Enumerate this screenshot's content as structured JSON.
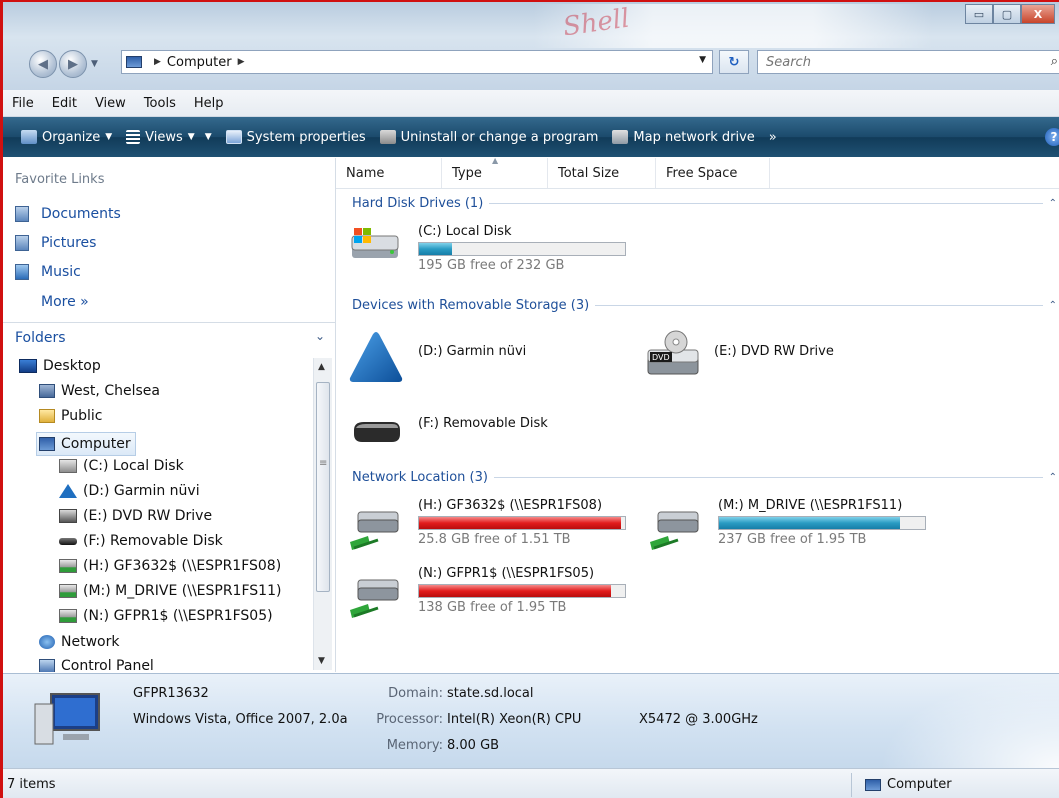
{
  "window": {
    "minimize_glyph": "▭",
    "maximize_glyph": "▢",
    "close_glyph": "X",
    "logo_text": "Shell"
  },
  "address": {
    "location": "Computer",
    "search_placeholder": "Search"
  },
  "menu": [
    "File",
    "Edit",
    "View",
    "Tools",
    "Help"
  ],
  "toolbar": {
    "organize": "Organize",
    "views": "Views",
    "system_properties": "System properties",
    "uninstall": "Uninstall or change a program",
    "map_drive": "Map network drive",
    "overflow": "»"
  },
  "nav": {
    "favorite_links_header": "Favorite Links",
    "favorites": [
      "Documents",
      "Pictures",
      "Music"
    ],
    "more": "More  »",
    "folders_header": "Folders",
    "tree": [
      {
        "label": "Desktop",
        "level": 0,
        "icon": "desktop-icon"
      },
      {
        "label": "West, Chelsea",
        "level": 1,
        "icon": "user-folder-icon"
      },
      {
        "label": "Public",
        "level": 1,
        "icon": "folder-icon"
      },
      {
        "label": "Computer",
        "level": 1,
        "icon": "computer-icon",
        "selected": true
      },
      {
        "label": "(C:) Local Disk",
        "level": 2,
        "icon": "local-disk-icon"
      },
      {
        "label": "(D:) Garmin nüvi",
        "level": 2,
        "icon": "garmin-icon"
      },
      {
        "label": "(E:) DVD RW Drive",
        "level": 2,
        "icon": "dvd-drive-icon"
      },
      {
        "label": "(F:) Removable Disk",
        "level": 2,
        "icon": "removable-disk-icon"
      },
      {
        "label": "(H:) GF3632$ (\\\\ESPR1FS08)",
        "level": 2,
        "icon": "network-drive-icon"
      },
      {
        "label": "(M:) M_DRIVE (\\\\ESPR1FS11)",
        "level": 2,
        "icon": "network-drive-icon"
      },
      {
        "label": "(N:) GFPR1$ (\\\\ESPR1FS05)",
        "level": 2,
        "icon": "network-drive-icon"
      },
      {
        "label": "Network",
        "level": 1,
        "icon": "network-icon"
      },
      {
        "label": "Control Panel",
        "level": 1,
        "icon": "control-panel-icon"
      }
    ]
  },
  "columns": [
    "Name",
    "Type",
    "Total Size",
    "Free Space"
  ],
  "groups": {
    "hdd": "Hard Disk Drives (1)",
    "removable": "Devices with Removable Storage (3)",
    "network": "Network Location (3)"
  },
  "drives": {
    "c": {
      "name": "(C:) Local Disk",
      "free": "195 GB free of 232 GB",
      "used_fraction": 0.16
    },
    "d": {
      "name": "(D:) Garmin nüvi"
    },
    "e": {
      "name": "(E:) DVD RW Drive",
      "badge": "DVD"
    },
    "f": {
      "name": "(F:) Removable Disk"
    },
    "h": {
      "name": "(H:) GF3632$ (\\\\ESPR1FS08)",
      "free": "25.8 GB free of 1.51 TB",
      "used_fraction": 0.98
    },
    "m": {
      "name": "(M:) M_DRIVE (\\\\ESPR1FS11)",
      "free": "237 GB free of 1.95 TB",
      "used_fraction": 0.88
    },
    "n": {
      "name": "(N:) GFPR1$ (\\\\ESPR1FS05)",
      "free": "138 GB free of 1.95 TB",
      "used_fraction": 0.93
    }
  },
  "details": {
    "computer_name": "GFPR13632",
    "description": "Windows Vista, Office 2007, 2.0a",
    "domain_label": "Domain:",
    "domain": "state.sd.local",
    "processor_label": "Processor:",
    "processor": "Intel(R) Xeon(R) CPU",
    "processor_model": "X5472  @ 3.00GHz",
    "memory_label": "Memory:",
    "memory": "8.00 GB"
  },
  "status": {
    "items": "7 items",
    "location": "Computer"
  },
  "colors": {
    "bar_blue": "#2a9cc3",
    "bar_red": "#e21c1c",
    "link_blue": "#1a4fa0",
    "toolbar_bg": "#1b4a6c"
  }
}
